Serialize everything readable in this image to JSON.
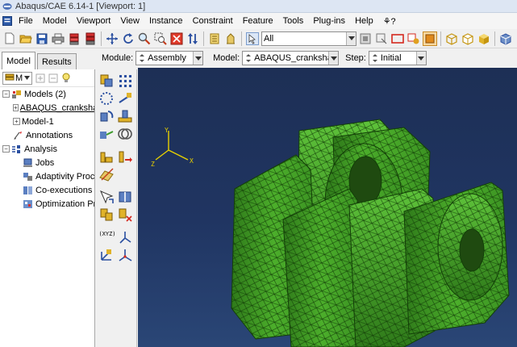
{
  "window": {
    "title": "Abaqus/CAE 6.14-1 [Viewport: 1]"
  },
  "menu": [
    "File",
    "Model",
    "Viewport",
    "View",
    "Instance",
    "Constraint",
    "Feature",
    "Tools",
    "Plug-ins",
    "Help",
    "⚘?"
  ],
  "toolbar": {
    "selection_filter": "All"
  },
  "context": {
    "module_label": "Module:",
    "module_value": "Assembly",
    "model_label": "Model:",
    "model_value": "ABAQUS_crankshaft",
    "step_label": "Step:",
    "step_value": "Initial"
  },
  "tabs": [
    "Model",
    "Results"
  ],
  "tree": {
    "filter_value": "M",
    "items": [
      {
        "label": "Models (2)",
        "expander": "−",
        "icon": "models-icon"
      },
      {
        "label": "ABAQUS_crankshaft",
        "expander": "+",
        "icon": ""
      },
      {
        "label": "Model-1",
        "expander": "+",
        "icon": ""
      },
      {
        "label": "Annotations",
        "expander": "",
        "icon": "annotations-icon"
      },
      {
        "label": "Analysis",
        "expander": "−",
        "icon": "analysis-icon"
      },
      {
        "label": "Jobs",
        "expander": "",
        "icon": "jobs-icon"
      },
      {
        "label": "Adaptivity Processes",
        "expander": "",
        "icon": "adaptivity-icon"
      },
      {
        "label": "Co-executions",
        "expander": "",
        "icon": "co-executions-icon"
      },
      {
        "label": "Optimization Processes",
        "expander": "",
        "icon": "optimization-icon"
      }
    ]
  },
  "triad": {
    "x": "X",
    "y": "Y",
    "z": "Z"
  },
  "toolbox": {
    "coord_label": "(XYZ)"
  },
  "colors": {
    "viewport_bg": "#203562",
    "mesh_green": "#3d9a22",
    "triad": "#e8d000",
    "selection": "#dbe7f7"
  }
}
